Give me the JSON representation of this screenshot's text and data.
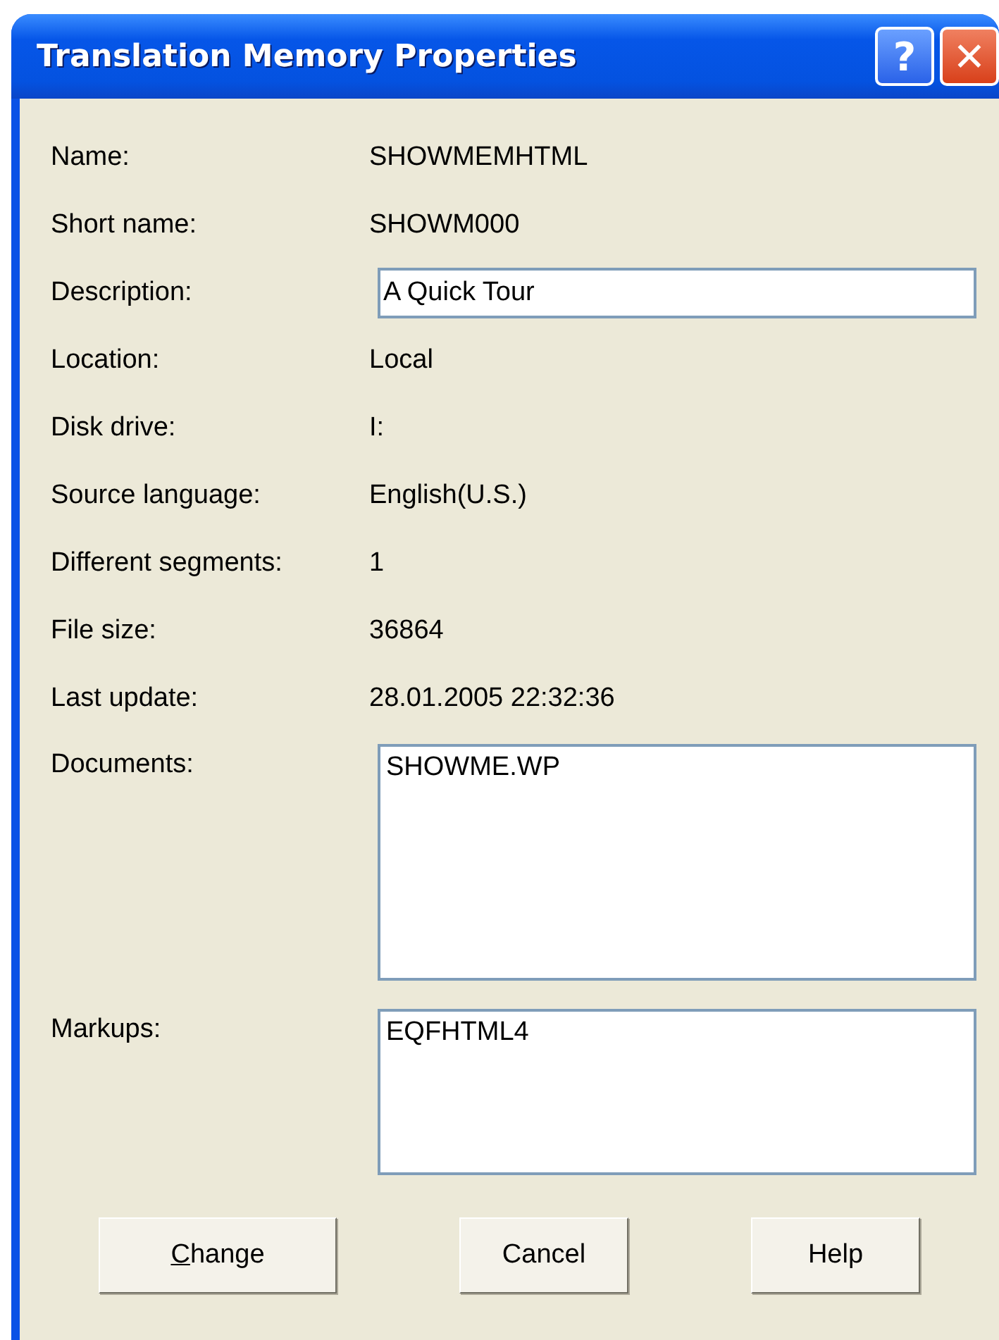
{
  "window": {
    "title": "Translation Memory Properties",
    "help_button": "?",
    "close_button": "✕"
  },
  "fields": [
    {
      "label": "Name:",
      "kind": "text",
      "value": "SHOWMEMHTML"
    },
    {
      "label": "Short name:",
      "kind": "text",
      "value": "SHOWM000"
    },
    {
      "label": "Description:",
      "kind": "field",
      "value": "A Quick Tour"
    },
    {
      "label": "Location:",
      "kind": "text",
      "value": "Local"
    },
    {
      "label": "Disk drive:",
      "kind": "text",
      "value": "I:"
    },
    {
      "label": "Source language:",
      "kind": "text",
      "value": "English(U.S.)"
    },
    {
      "label": "Different segments:",
      "kind": "text",
      "value": "1"
    },
    {
      "label": "File size:",
      "kind": "text",
      "value": "36864"
    },
    {
      "label": "Last update:",
      "kind": "text",
      "value": "28.01.2005 22:32:36"
    },
    {
      "label": "Documents:",
      "kind": "list",
      "items": [
        "SHOWME.WP"
      ]
    },
    {
      "label": "Markups:",
      "kind": "list",
      "items": [
        "EQFHTML4"
      ]
    }
  ],
  "buttons": [
    {
      "label": "Change",
      "first_letter_underlined": true
    },
    {
      "label": "Cancel"
    },
    {
      "label": "Help"
    }
  ]
}
